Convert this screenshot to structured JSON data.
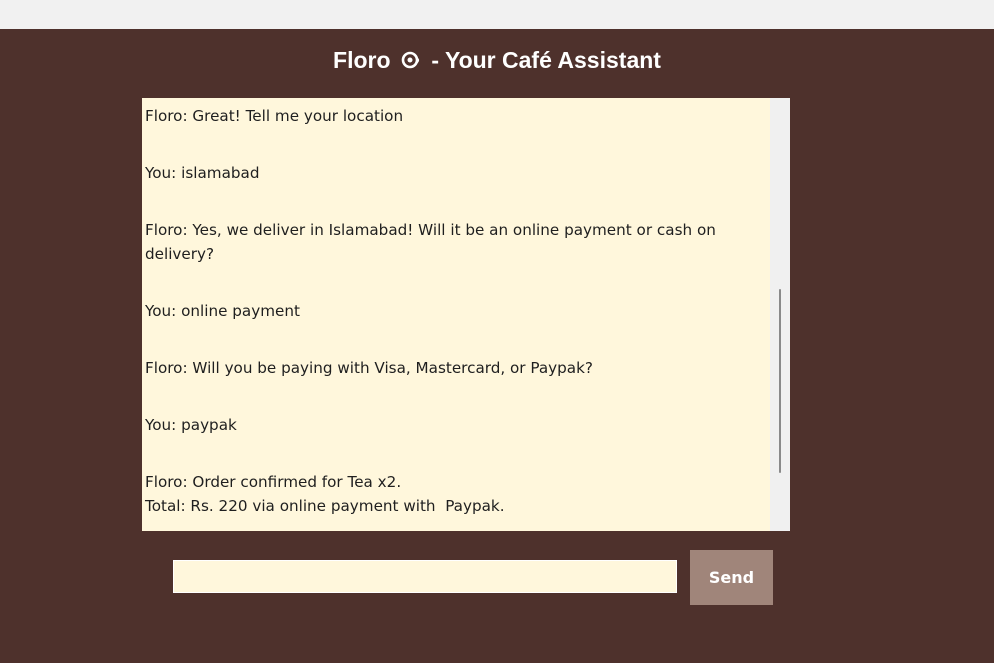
{
  "app": {
    "title_before_icon": "Floro",
    "title_icon": "coffee-cup-icon",
    "title_after_icon": "- Your Café Assistant"
  },
  "chat": {
    "messages": [
      "Floro: Great! Tell me your location",
      "You: islamabad",
      "Floro: Yes, we deliver in Islamabad! Will it be an online payment or cash on delivery?",
      "You: online payment",
      "Floro: Will you be paying with Visa, Mastercard, or Paypak?",
      "You: paypak",
      "Floro: Order confirmed for Tea x2.\nTotal: Rs. 220 via online payment with  Paypak."
    ]
  },
  "input": {
    "value": "",
    "placeholder": ""
  },
  "send": {
    "label": "Send"
  },
  "colors": {
    "background": "#4e312c",
    "chat_background": "#fff7dc",
    "send_button": "#a0857a",
    "title_text": "#ffffff"
  }
}
